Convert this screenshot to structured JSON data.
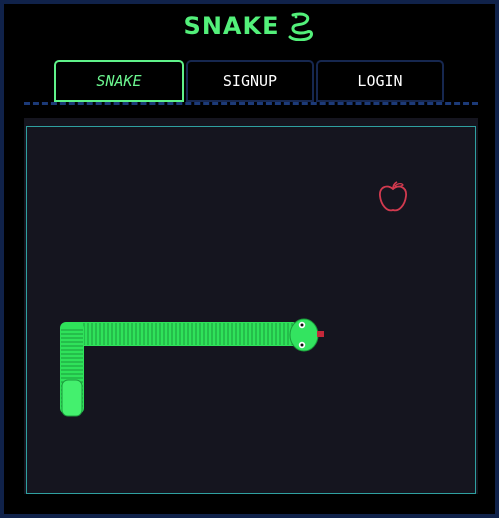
{
  "app": {
    "title": "SNAKE",
    "logo_icon": "snake-icon",
    "accent_color": "#53f07a"
  },
  "tabs": [
    {
      "label": "SNAKE",
      "active": true
    },
    {
      "label": "SIGNUP",
      "active": false
    },
    {
      "label": "LOGIN",
      "active": false
    }
  ],
  "game": {
    "board_color": "#15151f",
    "snake_color": "#2fe25a",
    "food": {
      "icon": "apple-icon",
      "color": "#d23a4f"
    }
  }
}
